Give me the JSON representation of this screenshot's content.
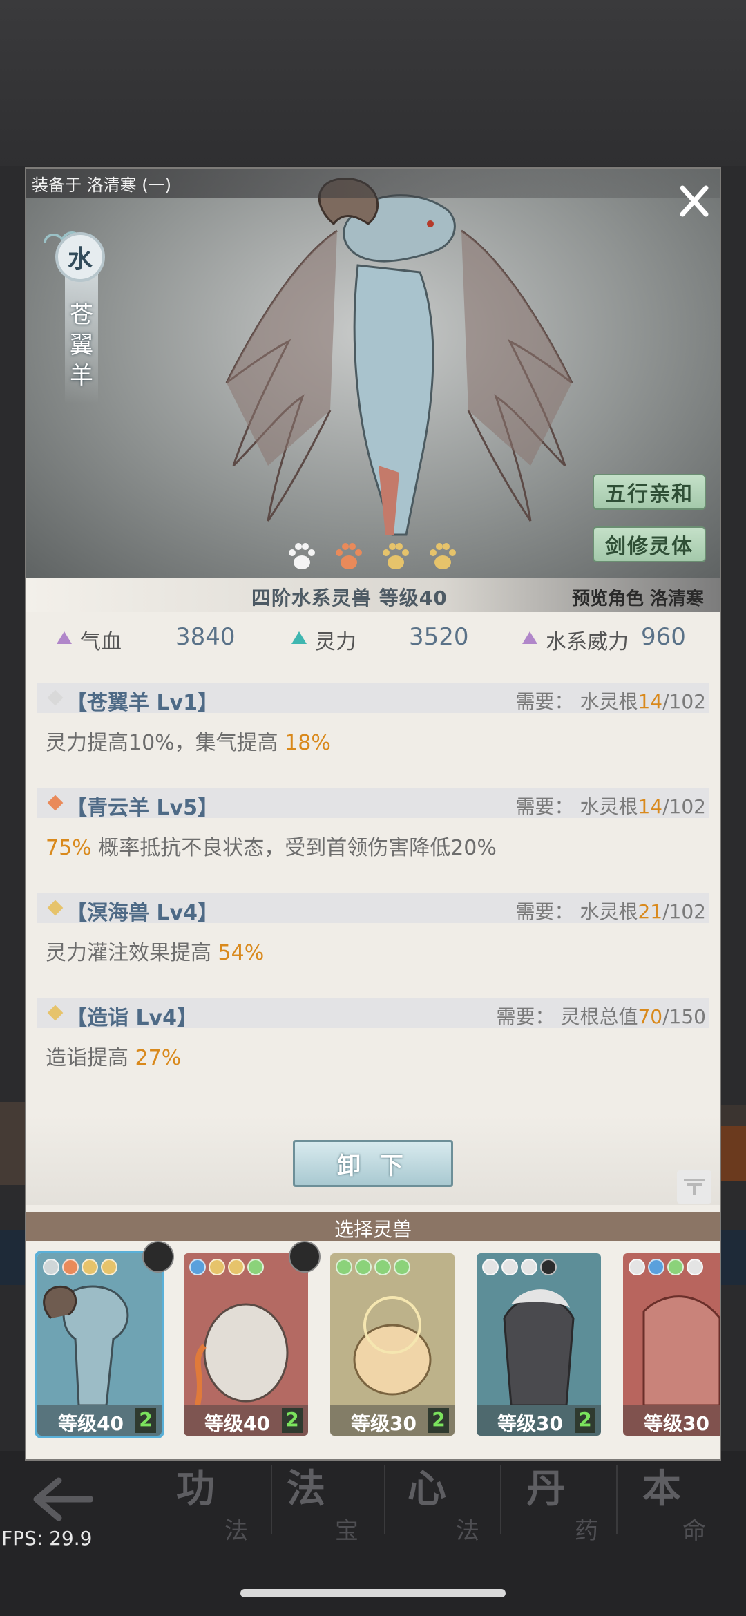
{
  "panel": {
    "equipped_label": "装备于 洛清寒 (一)",
    "element_char": "水",
    "beast_name": "苍翼羊",
    "buttons": {
      "five_elements": "五行亲和",
      "sword_body": "剑修灵体",
      "unequip": "卸 下"
    },
    "paws": [
      "white",
      "orange",
      "gold",
      "gold"
    ],
    "info": {
      "main": "四阶水系灵兽  等级40",
      "preview": "预览角色 洛清寒"
    },
    "stats": [
      {
        "label": "气血",
        "value": "3840",
        "color": "#b086c9"
      },
      {
        "label": "灵力",
        "value": "3520",
        "color": "#3fb6b0"
      },
      {
        "label": "水系威力",
        "value": "960",
        "color": "#b086c9"
      }
    ],
    "skills": [
      {
        "name": "【苍翼羊 Lv1】",
        "diamond": "#d9d9d9",
        "req_prefix": "需要：",
        "req_label": "水灵根",
        "req_cur": "14",
        "req_total": "/102",
        "desc_pre": "灵力提高10%，集气提高 ",
        "desc_hl": "18%",
        "desc_post": ""
      },
      {
        "name": "【青云羊 Lv5】",
        "diamond": "#e98a5a",
        "req_prefix": "需要：",
        "req_label": "水灵根",
        "req_cur": "14",
        "req_total": "/102",
        "desc_pre": "",
        "desc_hl": "75%",
        "desc_post": " 概率抵抗不良状态，受到首领伤害降低20%"
      },
      {
        "name": "【溟海兽 Lv4】",
        "diamond": "#e6c36b",
        "req_prefix": "需要：",
        "req_label": "水灵根",
        "req_cur": "21",
        "req_total": "/102",
        "desc_pre": "灵力灌注效果提高 ",
        "desc_hl": "54%",
        "desc_post": ""
      },
      {
        "name": "【造诣 Lv4】",
        "diamond": "#e6c36b",
        "req_prefix": "需要：",
        "req_label": "灵根总值",
        "req_cur": "70",
        "req_total": "/150",
        "desc_pre": "造诣提高 ",
        "desc_hl": "27%",
        "desc_post": ""
      }
    ],
    "select_title": "选择灵兽",
    "cards": [
      {
        "level": "等级40",
        "count": "2",
        "bg": "#6fa3b3",
        "selected": true,
        "dots": [
          "#cfd6d8",
          "#e98a5a",
          "#e6c36b",
          "#e6c36b"
        ]
      },
      {
        "level": "等级40",
        "count": "2",
        "bg": "#b46a63",
        "selected": false,
        "dots": [
          "#5aa0dc",
          "#e6c36b",
          "#e6c36b",
          "#8bd27a"
        ]
      },
      {
        "level": "等级30",
        "count": "2",
        "bg": "#bdb28a",
        "selected": false,
        "dots": [
          "#8bd27a",
          "#8bd27a",
          "#8bd27a",
          "#8bd27a"
        ]
      },
      {
        "level": "等级30",
        "count": "2",
        "bg": "#5d8e98",
        "selected": false,
        "dots": [
          "#e4e4e4",
          "#e4e4e4",
          "#e4e4e4",
          "#2c2c2c"
        ]
      },
      {
        "level": "等级30",
        "count": "",
        "bg": "#b8655e",
        "selected": false,
        "dots": [
          "#e4e4e4",
          "#5aa0dc",
          "#8bd27a",
          "#e4e4e4"
        ]
      }
    ]
  },
  "nav": [
    {
      "big": "功",
      "small": "法"
    },
    {
      "big": "法",
      "small": "宝"
    },
    {
      "big": "心",
      "small": "法"
    },
    {
      "big": "丹",
      "small": "药"
    },
    {
      "big": "本",
      "small": "命"
    }
  ],
  "fps": "FPS: 29.9"
}
